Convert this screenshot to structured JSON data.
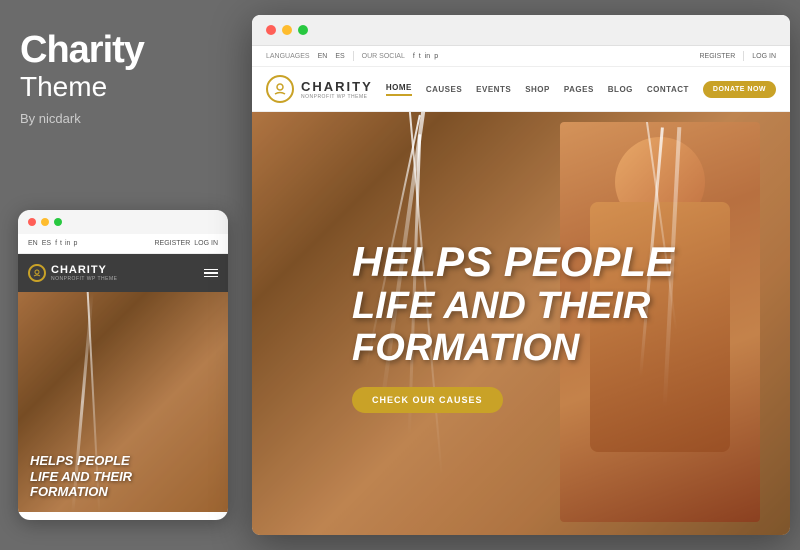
{
  "left": {
    "title_bold": "Charity",
    "title_regular": "Theme",
    "author": "By nicdark"
  },
  "mobile": {
    "traffic_lights": [
      "red",
      "yellow",
      "green"
    ],
    "topbar": {
      "lang1": "EN",
      "lang2": "ES",
      "register": "REGISTER",
      "login": "LOG IN"
    },
    "header": {
      "logo_text": "CHARITY",
      "logo_sub": "NONPROFIT WP THEME"
    },
    "hero": {
      "line1": "HELPS PEOPLE",
      "line2": "LIFE AND THEIR",
      "line3": "FORMATION"
    }
  },
  "desktop": {
    "traffic_lights": [
      "red",
      "yellow",
      "green"
    ],
    "topbar": {
      "languages": "LANGUAGES",
      "lang1": "EN",
      "lang2": "ES",
      "our_social": "OUR SOCIAL",
      "register": "REGISTER",
      "login": "LOG IN"
    },
    "nav": {
      "logo_name": "CHARITY",
      "logo_tagline": "NONPROFIT WP THEME",
      "links": [
        "HOME",
        "CAUSES",
        "EVENTS",
        "SHOP",
        "PAGES",
        "BLOG",
        "CONTACT"
      ],
      "active_link": "HOME",
      "donate_btn": "DONATE NOW"
    },
    "hero": {
      "line1": "HELPS PEOPLE",
      "line2": "LIFE AND THEIR",
      "line3": "FORMATION",
      "cta_btn": "CHECK OUR CAUSES"
    }
  }
}
